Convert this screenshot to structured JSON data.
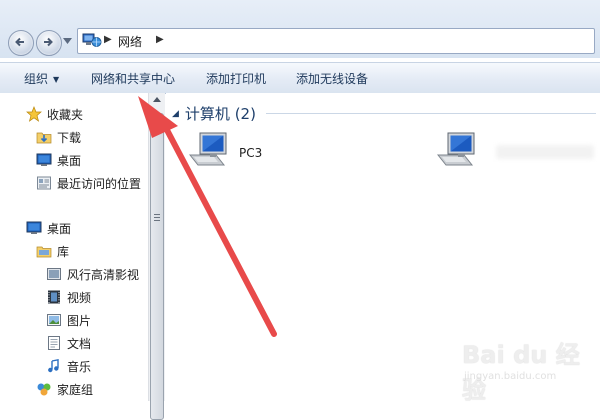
{
  "address": {
    "path": "网络"
  },
  "toolbar": {
    "organize_label": "组织",
    "network_center_label": "网络和共享中心",
    "add_printer_label": "添加打印机",
    "add_wireless_label": "添加无线设备"
  },
  "sidebar": {
    "favorites": {
      "label": "收藏夹",
      "items": [
        {
          "label": "下载",
          "icon": "download-folder-icon"
        },
        {
          "label": "桌面",
          "icon": "desktop-icon"
        },
        {
          "label": "最近访问的位置",
          "icon": "recent-places-icon"
        }
      ]
    },
    "desktop": {
      "label": "桌面",
      "items": [
        {
          "label": "库",
          "icon": "library-icon"
        },
        {
          "label": "风行高清影视",
          "icon": "video-library-icon"
        },
        {
          "label": "视频",
          "icon": "film-icon"
        },
        {
          "label": "图片",
          "icon": "pictures-icon"
        },
        {
          "label": "文档",
          "icon": "documents-icon"
        },
        {
          "label": "音乐",
          "icon": "music-icon"
        },
        {
          "label": "家庭组",
          "icon": "homegroup-icon"
        }
      ]
    }
  },
  "content": {
    "group_title": "计算机 (2)",
    "computers": [
      {
        "name": "PC3"
      },
      {
        "name": ""
      }
    ]
  },
  "annotation": {
    "color": "#e84a4a"
  },
  "watermark": {
    "text": "Bai du 经验",
    "subtext": "jingyan.baidu.com"
  },
  "colors": {
    "toolbar_text": "#1e395b",
    "group_header": "#1e3f6b"
  }
}
